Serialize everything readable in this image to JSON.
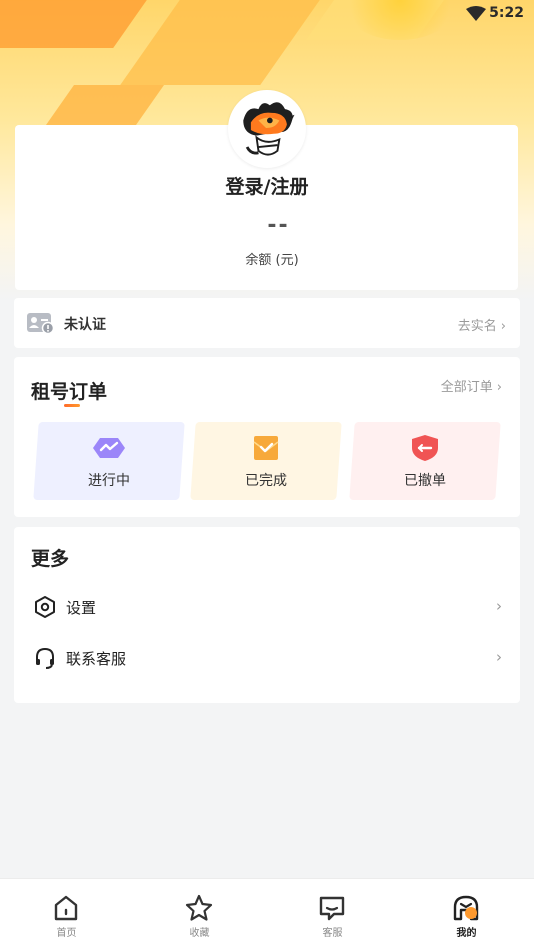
{
  "status_bar": {
    "time": "5:22",
    "wifi_icon": "wifi-icon"
  },
  "profile": {
    "avatar_icon": "dragon-avatar-icon",
    "login_label": "登录/注册",
    "balance_value": "--",
    "balance_label": "余额 (元)"
  },
  "verification": {
    "icon": "id-card-icon",
    "status_label": "未认证",
    "action_label": "去实名"
  },
  "orders": {
    "title": "租号订单",
    "view_all_label": "全部订单",
    "tiles": [
      {
        "label": "进行中",
        "icon": "in-progress-icon",
        "color": "#8f7cf7"
      },
      {
        "label": "已完成",
        "icon": "completed-icon",
        "color": "#f7a93b"
      },
      {
        "label": "已撤单",
        "icon": "cancelled-icon",
        "color": "#f05454"
      }
    ]
  },
  "more": {
    "title": "更多",
    "items": [
      {
        "label": "设置",
        "icon": "settings-icon"
      },
      {
        "label": "联系客服",
        "icon": "headset-icon"
      }
    ]
  },
  "tabbar": {
    "active": "我的",
    "tabs": [
      {
        "label": "首页",
        "icon": "home-icon"
      },
      {
        "label": "收藏",
        "icon": "star-icon"
      },
      {
        "label": "客服",
        "icon": "message-icon"
      },
      {
        "label": "我的",
        "icon": "mine-icon"
      }
    ]
  },
  "colors": {
    "accent": "#ff8a2a",
    "background": "#f3f4f5"
  }
}
